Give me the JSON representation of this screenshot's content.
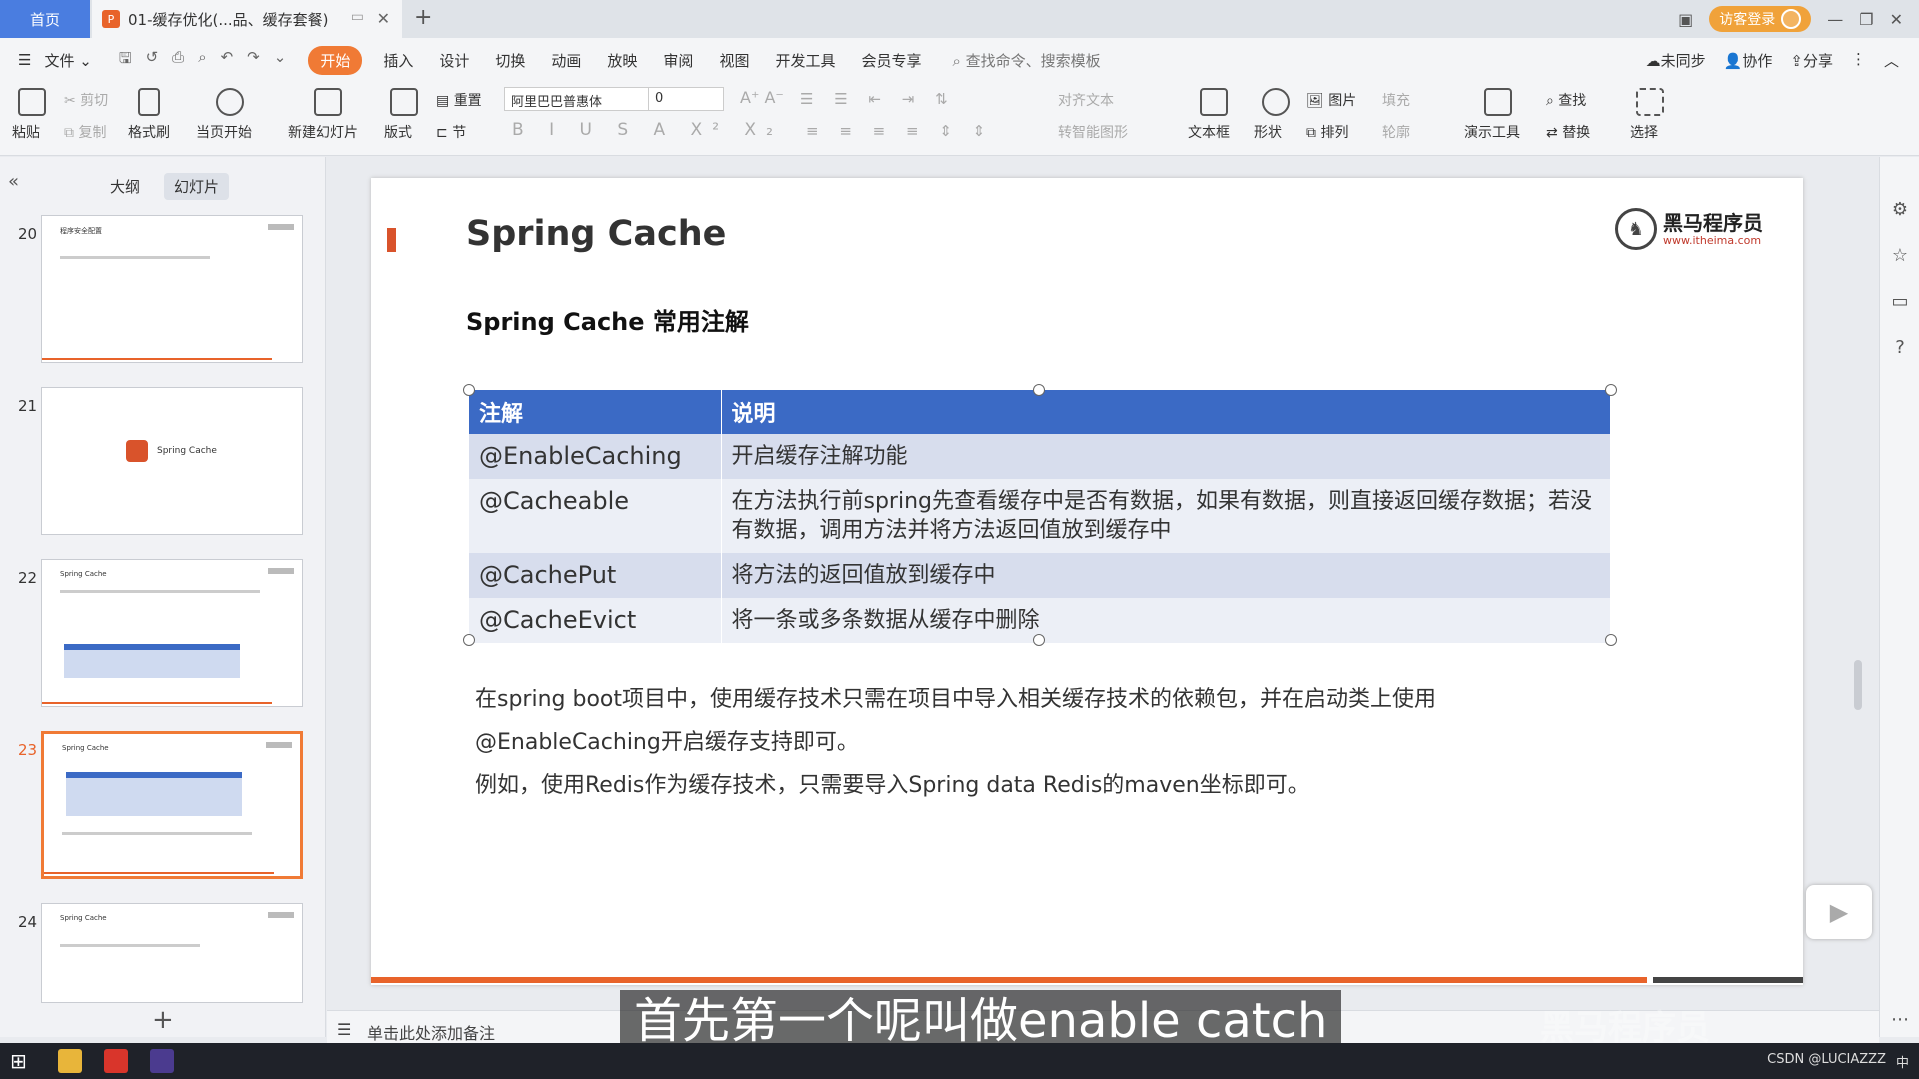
{
  "tabs": {
    "home": "首页",
    "doc": "01-缓存优化(...品、缓存套餐)",
    "guest_login": "访客登录"
  },
  "menu": {
    "file": "文件",
    "items": [
      "开始",
      "插入",
      "设计",
      "切换",
      "动画",
      "放映",
      "审阅",
      "视图",
      "开发工具",
      "会员专享"
    ],
    "active": "开始",
    "search": "查找命令、搜索模板",
    "not_synced": "未同步",
    "collab": "协作",
    "share": "分享"
  },
  "ribbon": {
    "paste": "粘贴",
    "cut": "剪切",
    "copy": "复制",
    "format_painter": "格式刷",
    "from_current": "当页开始",
    "new_slide": "新建幻灯片",
    "layout": "版式",
    "reset": "重置",
    "section": "节",
    "font": "阿里巴巴普惠体",
    "size": "0",
    "align_text": "对齐文本",
    "smart_shape": "转智能图形",
    "textbox": "文本框",
    "shape": "形状",
    "picture": "图片",
    "arrange": "排列",
    "fill": "填充",
    "outline": "轮廓",
    "present_tools": "演示工具",
    "find": "查找",
    "replace": "替换",
    "select": "选择"
  },
  "left_panel": {
    "outline_tab": "大纲",
    "slides_tab": "幻灯片",
    "thumbs": [
      {
        "num": "20",
        "title": "程序安全配置"
      },
      {
        "num": "21",
        "title": "Spring Cache"
      },
      {
        "num": "22",
        "title": "Spring Cache"
      },
      {
        "num": "23",
        "title": "Spring Cache"
      },
      {
        "num": "24",
        "title": "Spring Cache"
      }
    ],
    "selected": "23"
  },
  "slide": {
    "title": "Spring Cache",
    "subtitle": "Spring Cache 常用注解",
    "brand_name": "黑马程序员",
    "brand_url": "www.itheima.com",
    "table": {
      "headers": [
        "注解",
        "说明"
      ],
      "rows": [
        [
          "@EnableCaching",
          "开启缓存注解功能"
        ],
        [
          "@Cacheable",
          "在方法执行前spring先查看缓存中是否有数据，如果有数据，则直接返回缓存数据；若没有数据，调用方法并将方法返回值放到缓存中"
        ],
        [
          "@CachePut",
          "将方法的返回值放到缓存中"
        ],
        [
          "@CacheEvict",
          "将一条或多条数据从缓存中删除"
        ]
      ]
    },
    "paragraph_1": "在spring boot项目中，使用缓存技术只需在项目中导入相关缓存技术的依赖包，并在启动类上使用@EnableCaching开启缓存支持即可。",
    "paragraph_2": "例如，使用Redis作为缓存技术，只需要导入Spring data Redis的maven坐标即可。"
  },
  "notes_placeholder": "单击此处添加备注",
  "subtitle_caption": "首先第一个呢叫做enable catch",
  "watermark": "黑马程序员",
  "taskbar": {
    "right_text": "CSDN @LUCIAZZZ",
    "ime": "中"
  }
}
